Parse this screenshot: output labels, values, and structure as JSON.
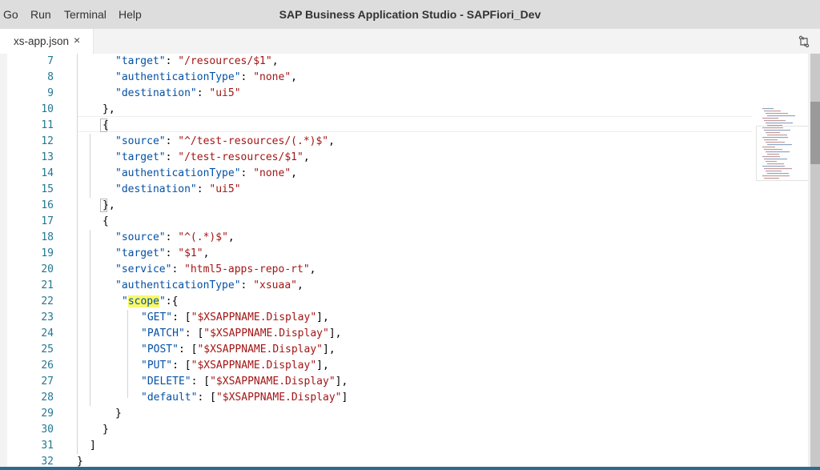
{
  "menu": [
    "Go",
    "Run",
    "Terminal",
    "Help"
  ],
  "window_title": "SAP Business Application Studio - SAPFiori_Dev",
  "tab": {
    "label": "xs-app.json",
    "close_glyph": "×"
  },
  "icons": {
    "compare": "compare-changes-icon",
    "close": "close-icon"
  },
  "colors": {
    "key": "#0451a5",
    "string": "#a31515",
    "line_number": "#237893",
    "highlight": "#f8f86b"
  },
  "editor": {
    "lines": [
      {
        "num": "7",
        "tokens": [
          {
            "t": "\"target\"",
            "c": "key"
          },
          {
            "t": ": "
          },
          {
            "t": "\"/resources/$1\"",
            "c": "str"
          },
          {
            "t": ","
          }
        ]
      },
      {
        "num": "8",
        "tokens": [
          {
            "t": "\"authenticationType\"",
            "c": "key"
          },
          {
            "t": ": "
          },
          {
            "t": "\"none\"",
            "c": "str"
          },
          {
            "t": ","
          }
        ]
      },
      {
        "num": "9",
        "tokens": [
          {
            "t": "\"destination\"",
            "c": "key"
          },
          {
            "t": ": "
          },
          {
            "t": "\"ui5\"",
            "c": "str"
          }
        ]
      },
      {
        "num": "10",
        "tokens": [
          {
            "t": "},"
          }
        ]
      },
      {
        "num": "11",
        "tokens": [
          {
            "t": "{"
          }
        ]
      },
      {
        "num": "12",
        "tokens": [
          {
            "t": "\"source\"",
            "c": "key"
          },
          {
            "t": ": "
          },
          {
            "t": "\"^/test-resources/(.*)$\"",
            "c": "str"
          },
          {
            "t": ","
          }
        ]
      },
      {
        "num": "13",
        "tokens": [
          {
            "t": "\"target\"",
            "c": "key"
          },
          {
            "t": ": "
          },
          {
            "t": "\"/test-resources/$1\"",
            "c": "str"
          },
          {
            "t": ","
          }
        ]
      },
      {
        "num": "14",
        "tokens": [
          {
            "t": "\"authenticationType\"",
            "c": "key"
          },
          {
            "t": ": "
          },
          {
            "t": "\"none\"",
            "c": "str"
          },
          {
            "t": ","
          }
        ]
      },
      {
        "num": "15",
        "tokens": [
          {
            "t": "\"destination\"",
            "c": "key"
          },
          {
            "t": ": "
          },
          {
            "t": "\"ui5\"",
            "c": "str"
          }
        ]
      },
      {
        "num": "16",
        "tokens": [
          {
            "t": "},"
          }
        ]
      },
      {
        "num": "17",
        "tokens": [
          {
            "t": "{"
          }
        ]
      },
      {
        "num": "18",
        "tokens": [
          {
            "t": "\"source\"",
            "c": "key"
          },
          {
            "t": ": "
          },
          {
            "t": "\"^(.*)$\"",
            "c": "str"
          },
          {
            "t": ","
          }
        ]
      },
      {
        "num": "19",
        "tokens": [
          {
            "t": "\"target\"",
            "c": "key"
          },
          {
            "t": ": "
          },
          {
            "t": "\"$1\"",
            "c": "str"
          },
          {
            "t": ","
          }
        ]
      },
      {
        "num": "20",
        "tokens": [
          {
            "t": "\"service\"",
            "c": "key"
          },
          {
            "t": ": "
          },
          {
            "t": "\"html5-apps-repo-rt\"",
            "c": "str"
          },
          {
            "t": ","
          }
        ]
      },
      {
        "num": "21",
        "tokens": [
          {
            "t": "\"authenticationType\"",
            "c": "key"
          },
          {
            "t": ": "
          },
          {
            "t": "\"xsuaa\"",
            "c": "str"
          },
          {
            "t": ","
          }
        ]
      },
      {
        "num": "22",
        "tokens": [
          {
            "t": "\"",
            "c": "key"
          },
          {
            "t": "scope",
            "c": "key hl"
          },
          {
            "t": "\"",
            "c": "key"
          },
          {
            "t": ":{"
          }
        ]
      },
      {
        "num": "23",
        "tokens": [
          {
            "t": "\"GET\"",
            "c": "key"
          },
          {
            "t": ": ["
          },
          {
            "t": "\"$XSAPPNAME.Display\"",
            "c": "str"
          },
          {
            "t": "],"
          }
        ]
      },
      {
        "num": "24",
        "tokens": [
          {
            "t": "\"PATCH\"",
            "c": "key"
          },
          {
            "t": ": ["
          },
          {
            "t": "\"$XSAPPNAME.Display\"",
            "c": "str"
          },
          {
            "t": "],"
          }
        ]
      },
      {
        "num": "25",
        "tokens": [
          {
            "t": "\"POST\"",
            "c": "key"
          },
          {
            "t": ": ["
          },
          {
            "t": "\"$XSAPPNAME.Display\"",
            "c": "str"
          },
          {
            "t": "],"
          }
        ]
      },
      {
        "num": "26",
        "tokens": [
          {
            "t": "\"PUT\"",
            "c": "key"
          },
          {
            "t": ": ["
          },
          {
            "t": "\"$XSAPPNAME.Display\"",
            "c": "str"
          },
          {
            "t": "],"
          }
        ]
      },
      {
        "num": "27",
        "tokens": [
          {
            "t": "\"DELETE\"",
            "c": "key"
          },
          {
            "t": ": ["
          },
          {
            "t": "\"$XSAPPNAME.Display\"",
            "c": "str"
          },
          {
            "t": "],"
          }
        ]
      },
      {
        "num": "28",
        "tokens": [
          {
            "t": "\"default\"",
            "c": "key"
          },
          {
            "t": ": ["
          },
          {
            "t": "\"$XSAPPNAME.Display\"",
            "c": "str"
          },
          {
            "t": "]"
          }
        ]
      },
      {
        "num": "29",
        "tokens": [
          {
            "t": "}"
          }
        ]
      },
      {
        "num": "30",
        "tokens": [
          {
            "t": "}"
          }
        ]
      },
      {
        "num": "31",
        "tokens": [
          {
            "t": "]"
          }
        ]
      },
      {
        "num": "32",
        "tokens": [
          {
            "t": "}"
          }
        ]
      }
    ]
  }
}
